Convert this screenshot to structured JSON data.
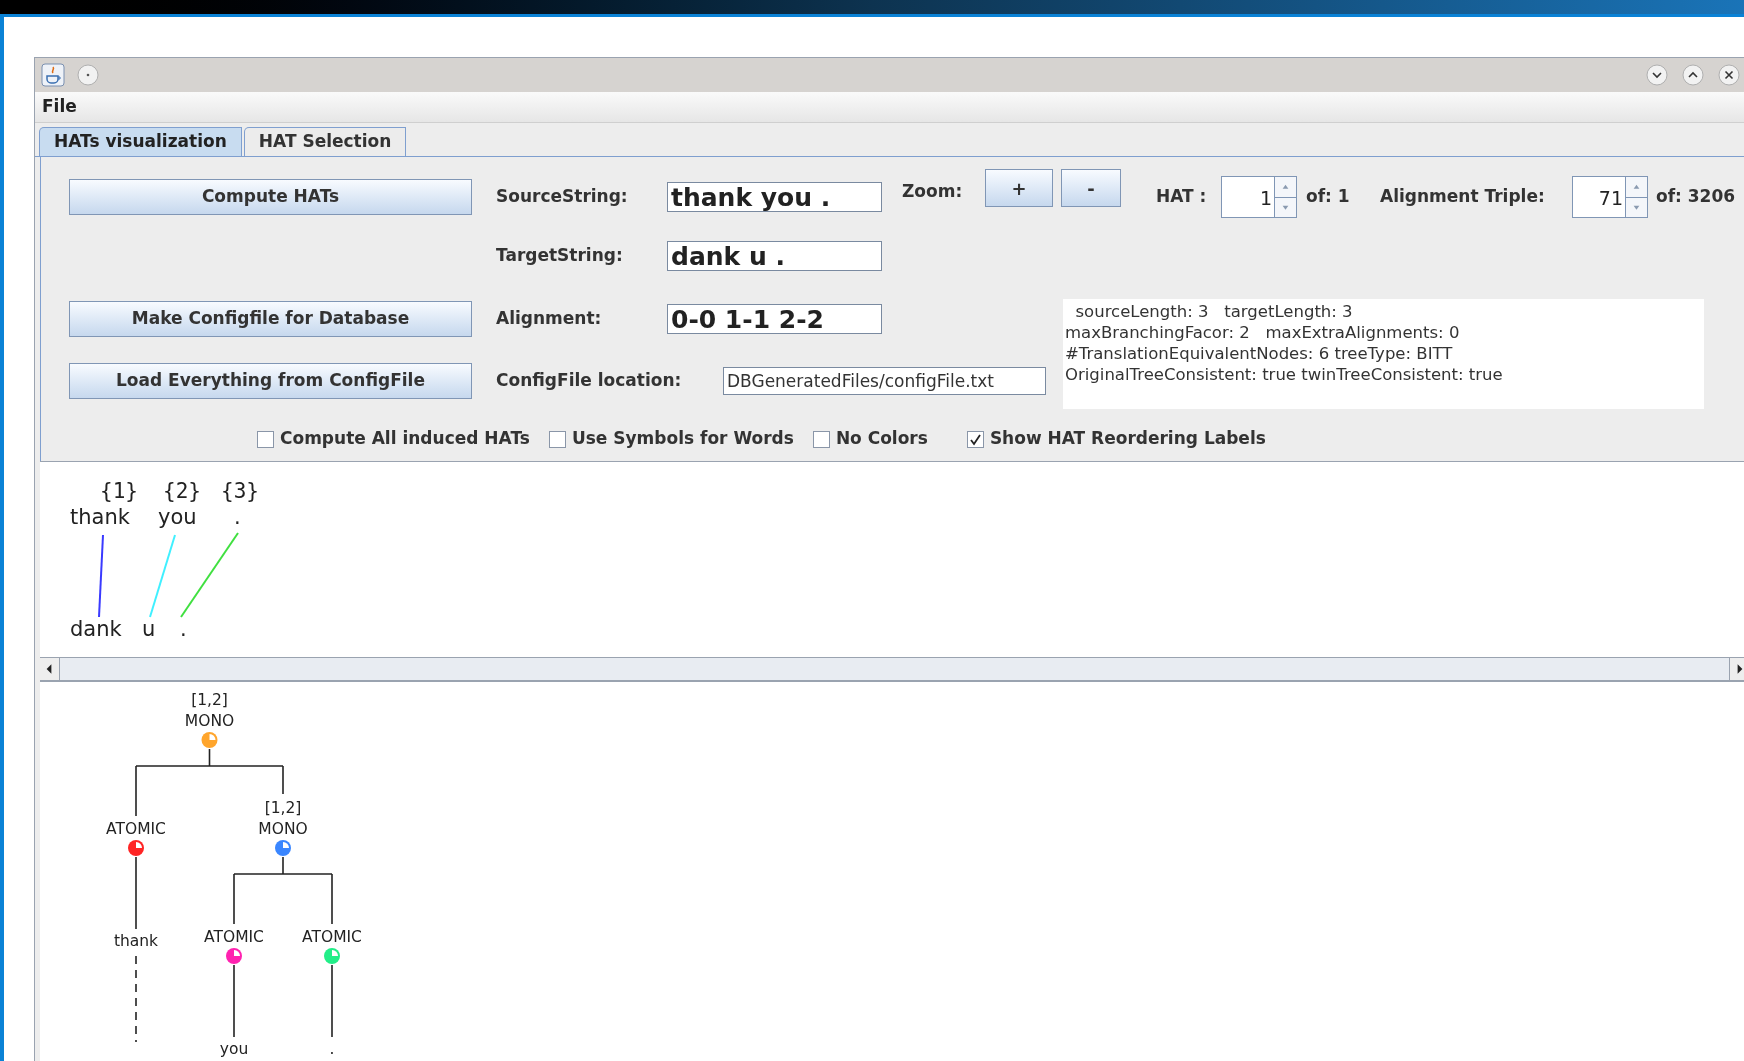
{
  "menu_bar": [
    "File"
  ],
  "tabs": [
    {
      "label": "HATs visualization",
      "selected": true
    },
    {
      "label": "HAT Selection",
      "selected": false
    }
  ],
  "compute_button": "Compute HATs",
  "source_string": {
    "label": "SourceString:",
    "value": "thank you ."
  },
  "zoom": {
    "label": "Zoom:",
    "buttons": [
      "+",
      "-"
    ]
  },
  "hat": {
    "label": "HAT :",
    "value": "1",
    "total": "of: 1"
  },
  "alignment_triple": {
    "label": "Alignment Triple:",
    "value": "71",
    "total": "of: 3206"
  },
  "target_string": {
    "label": "TargetString:",
    "value": "dank u ."
  },
  "make_config_button": "Make Configfile for Database",
  "alignment": {
    "label": "Alignment:",
    "value": "0-0 1-1 2-2"
  },
  "load_button": "Load Everything from ConfigFile",
  "config_file": {
    "label": "ConfigFile location:",
    "value": "DBGeneratedFiles/configFile.txt"
  },
  "info_lines": [
    "  sourceLength: 3   targetLength: 3",
    "maxBranchingFacor: 2   maxExtraAlignments: 0",
    "#TranslationEquivalentNodes: 6 treeType: BITT",
    "OriginalTreeConsistent: true twinTreeConsistent: true"
  ],
  "checkboxes": [
    {
      "label": "Compute All induced HATs",
      "checked": false
    },
    {
      "label": "Use Symbols for Words",
      "checked": false
    },
    {
      "label": "No Colors",
      "checked": false
    },
    {
      "label": "Show HAT Reordering Labels",
      "checked": true
    }
  ],
  "alignment_view": {
    "source_indices": [
      "{1}",
      "{2}",
      "{3}"
    ],
    "source_words": [
      "thank",
      "you",
      "."
    ],
    "target_words": [
      "dank",
      "u",
      "."
    ],
    "links": [
      {
        "color": "#3a3aff"
      },
      {
        "color": "#40f0ff"
      },
      {
        "color": "#40e040"
      }
    ]
  },
  "tree": {
    "span": "[1,2]",
    "label": "MONO",
    "color": "#ffa52c",
    "children": [
      {
        "label": "ATOMIC",
        "color": "#ff2424",
        "word": "thank"
      },
      {
        "span": "[1,2]",
        "label": "MONO",
        "color": "#3a86ff",
        "children": [
          {
            "label": "ATOMIC",
            "color": "#ff22b0",
            "word": "you"
          },
          {
            "label": "ATOMIC",
            "color": "#22ee88",
            "word": "."
          }
        ]
      }
    ]
  }
}
